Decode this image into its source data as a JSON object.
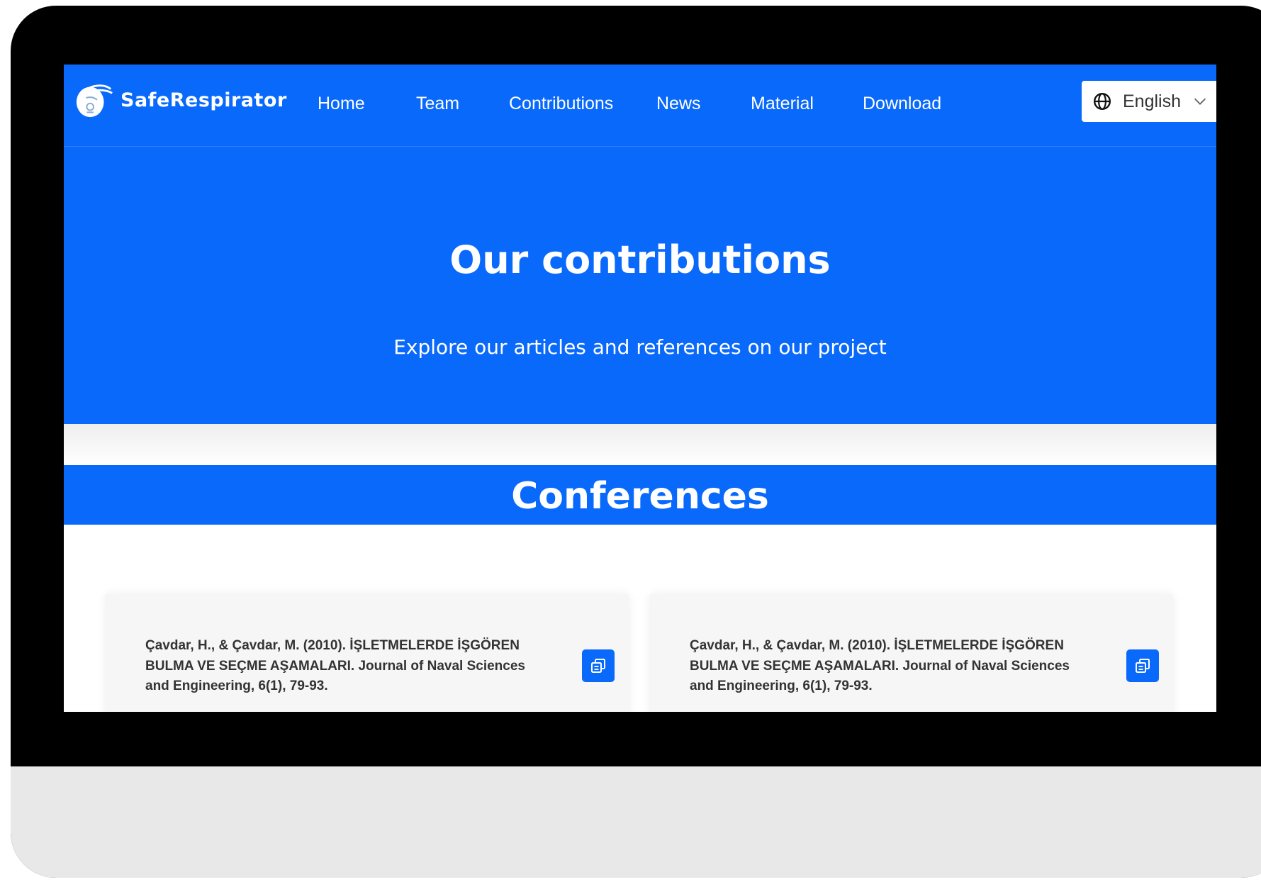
{
  "brand": {
    "name": "SafeRespirator"
  },
  "nav": {
    "items": [
      {
        "label": "Home"
      },
      {
        "label": "Team"
      },
      {
        "label": "Contributions"
      },
      {
        "label": "News"
      },
      {
        "label": "Material"
      },
      {
        "label": "Download"
      }
    ],
    "language": {
      "selected": "English"
    }
  },
  "hero": {
    "title": "Our contributions",
    "subtitle": "Explore our articles and references on our project"
  },
  "conferences": {
    "title": "Conferences",
    "cards": [
      {
        "citation": "Çavdar, H., & Çavdar, M. (2010). İŞLETMELERDE İŞGÖREN BULMA VE SEÇME AŞAMALARI. Journal of Naval Sciences and Engineering, 6(1), 79-93."
      },
      {
        "citation": "Çavdar, H., & Çavdar, M. (2010). İŞLETMELERDE İŞGÖREN BULMA VE SEÇME AŞAMALARI. Journal of Naval Sciences and Engineering, 6(1), 79-93."
      }
    ]
  },
  "colors": {
    "primary": "#0969fb",
    "frame": "#000000",
    "monitor_chin": "#e8e8e8",
    "card_bg": "#f6f6f6"
  },
  "icons": {
    "logo": "mask-logo-icon",
    "language": "globe-icon",
    "dropdown": "chevron-down-icon",
    "copy": "copy-icon"
  }
}
